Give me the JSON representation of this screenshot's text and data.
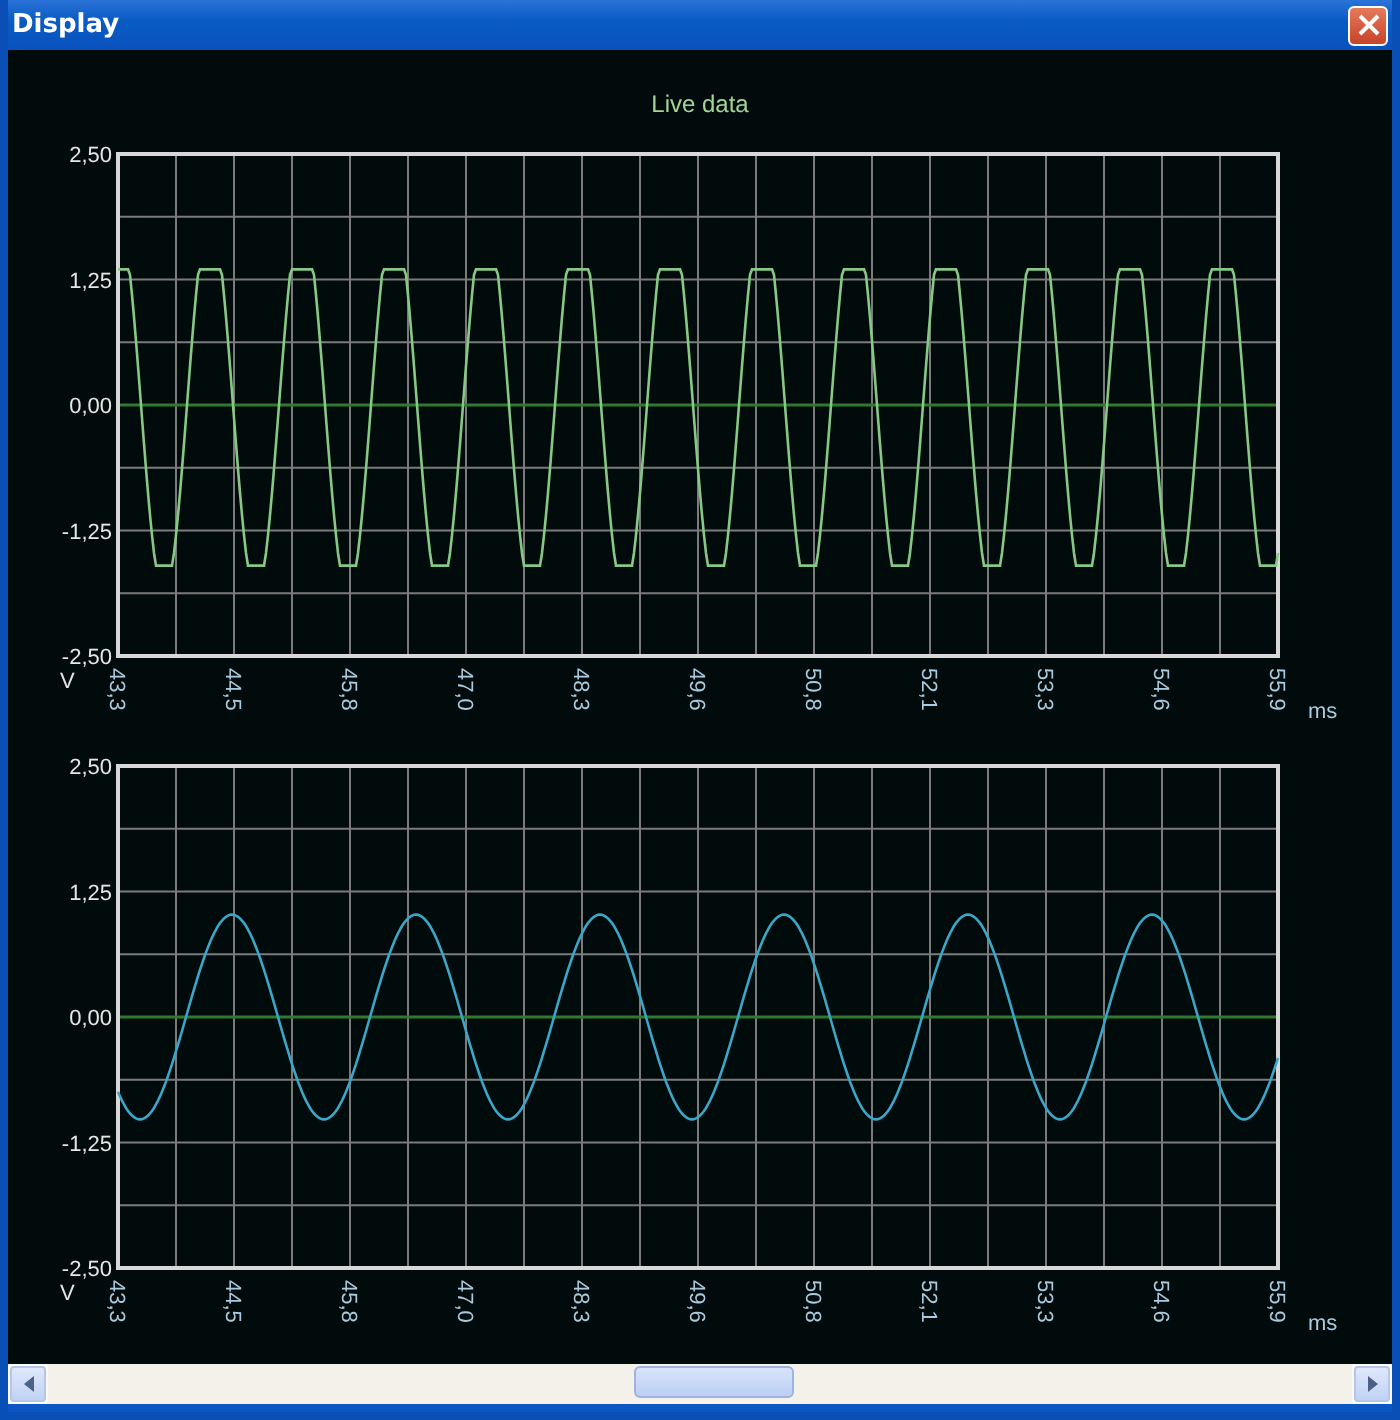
{
  "window": {
    "title": "Display"
  },
  "plot_title": "Live data",
  "charts": [
    {
      "y_ticks": [
        "2,50",
        "1,25",
        "0,00",
        "-1,25",
        "-2,50"
      ],
      "y_unit": "V",
      "x_ticks": [
        "43,3",
        "44,5",
        "45,8",
        "47,0",
        "48,3",
        "49,6",
        "50,8",
        "52,1",
        "53,3",
        "54,6",
        "55,9"
      ],
      "x_unit": "ms",
      "trace": {
        "kind": "clipped",
        "color": "#86c986"
      }
    },
    {
      "y_ticks": [
        "2,50",
        "1,25",
        "0,00",
        "-1,25",
        "-2,50"
      ],
      "y_unit": "V",
      "x_ticks": [
        "43,3",
        "44,5",
        "45,8",
        "47,0",
        "48,3",
        "49,6",
        "50,8",
        "52,1",
        "53,3",
        "54,6",
        "55,9"
      ],
      "x_unit": "ms",
      "trace": {
        "kind": "sine",
        "color": "#3aa6c8"
      }
    }
  ]
}
